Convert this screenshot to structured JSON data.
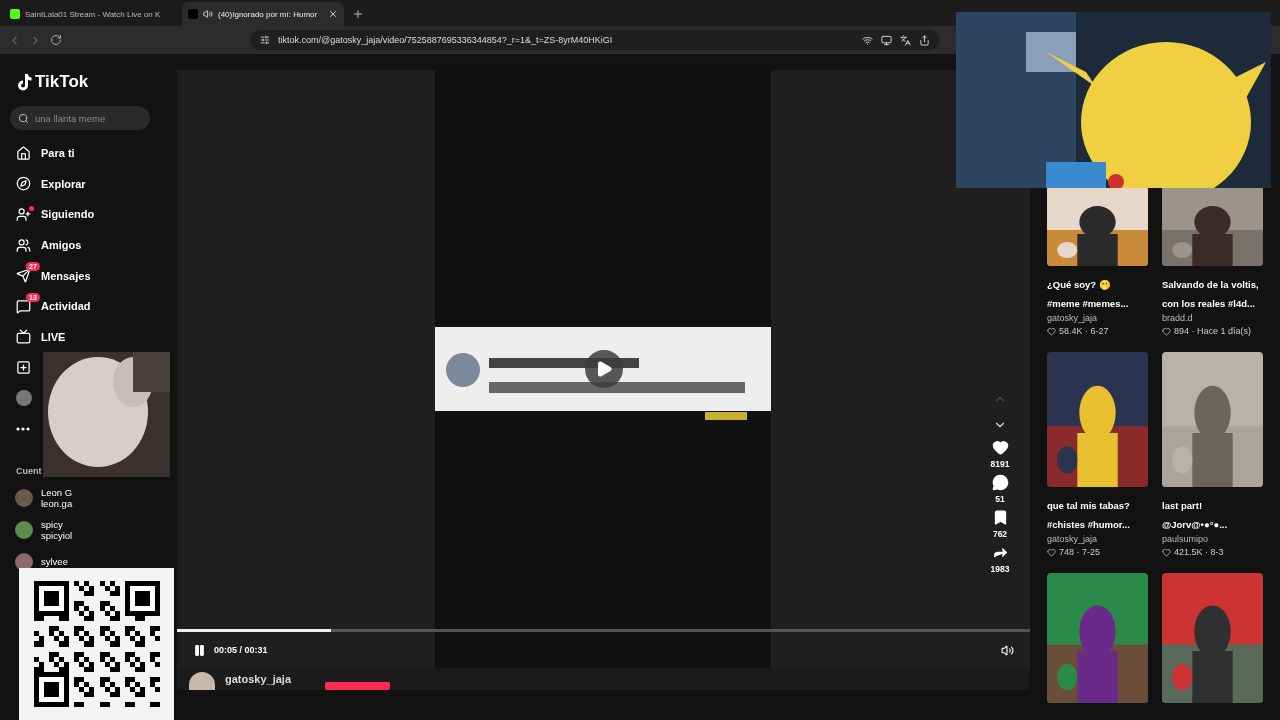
{
  "browser": {
    "tabs": [
      {
        "title": "SaintLala01 Stream - Watch Live on K",
        "selected": false,
        "audio": false
      },
      {
        "title": "(40)Ignorado por mí: Humor",
        "selected": true,
        "audio": true
      }
    ],
    "url": "tiktok.com/@gatosky_jaja/video/7525887695336344854?_r=1&_t=ZS-8yrM40HKiGI"
  },
  "sidebar": {
    "logo": "TikTok",
    "search": {
      "placeholder": "una llanta meme"
    },
    "items": [
      {
        "label": "Para ti"
      },
      {
        "label": "Explorar"
      },
      {
        "label": "Siguiendo",
        "dot": true
      },
      {
        "label": "Amigos"
      },
      {
        "label": "Mensajes",
        "badge": "27"
      },
      {
        "label": "Actividad",
        "badge": "13"
      },
      {
        "label": "LIVE"
      },
      {
        "kind": "upload"
      },
      {
        "kind": "profile"
      },
      {
        "kind": "more"
      }
    ],
    "accounts_heading": "Cuent",
    "accounts": [
      {
        "name": "Leon G",
        "handle": "leon.ga",
        "color": "#6b5a4a"
      },
      {
        "name": "spicy",
        "handle": "spicyiol",
        "color": "#5d8a4e"
      },
      {
        "name": "sylvee",
        "color": "#8a6a6a"
      }
    ]
  },
  "player": {
    "playing": true,
    "level": 0.18,
    "time": "00:05 / 00:31",
    "muted": false,
    "nav": [
      {
        "kind": "up",
        "disabled": true
      },
      {
        "kind": "down",
        "disabled": false
      }
    ],
    "actions": [
      {
        "kind": "like",
        "count": "8191"
      },
      {
        "kind": "comment",
        "count": "51"
      },
      {
        "kind": "save",
        "count": "762"
      },
      {
        "kind": "share",
        "count": "1983"
      }
    ],
    "author": "gatosky_jaja"
  },
  "recommended": [
    {
      "title": [
        "¿Qué soy? 🫢",
        "#meme #memes..."
      ],
      "author": "gatosky_jaja",
      "stats": "58.4K · 6-27"
    },
    {
      "title": [
        "Salvando de la voltis,",
        "con los reales #l4d..."
      ],
      "author": "bradd.d",
      "stats": "894 · Hace 1 día(s)"
    },
    {
      "title": [
        "que tal mis tabas?",
        "#chistes #humor..."
      ],
      "author": "gatosky_jaja",
      "stats": "748 · 7-25"
    },
    {
      "title": [
        "last part!",
        "@Jorv@•●°●..."
      ],
      "author": "paulsumipo",
      "stats": "421.5K · 8-3"
    },
    {
      "kind": "picture"
    },
    {
      "kind": "picture"
    }
  ]
}
